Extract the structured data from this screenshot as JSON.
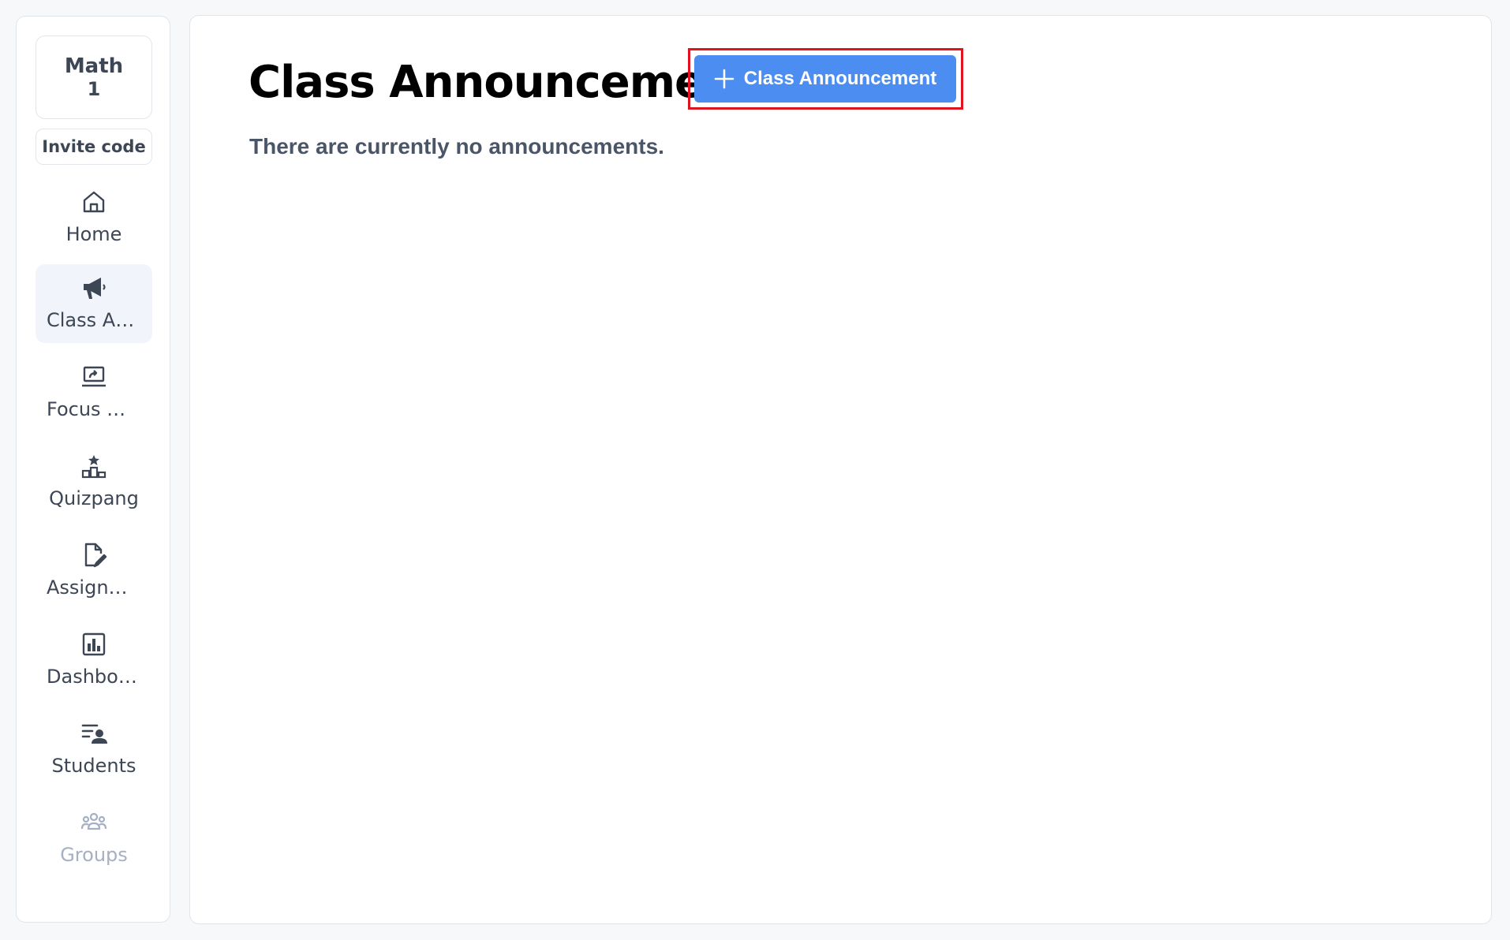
{
  "sidebar": {
    "class_name": "Math",
    "class_number": "1",
    "invite_label": "Invite code",
    "items": [
      {
        "label": "Home",
        "icon": "home-icon"
      },
      {
        "label": "Class Announcement",
        "icon": "megaphone-icon",
        "active": true
      },
      {
        "label": "Focus Mode",
        "icon": "screen-share-icon"
      },
      {
        "label": "Quizpang",
        "icon": "podium-icon"
      },
      {
        "label": "Assignment",
        "icon": "edit-document-icon"
      },
      {
        "label": "Dashboard",
        "icon": "bar-chart-icon"
      },
      {
        "label": "Students",
        "icon": "student-list-icon"
      },
      {
        "label": "Groups",
        "icon": "group-icon",
        "disabled": true
      }
    ]
  },
  "main": {
    "title": "Class Announcement",
    "add_button_label": "Class Announcement",
    "empty_message": "There are currently no announcements."
  },
  "colors": {
    "accent": "#4b8df0",
    "highlight_border": "#e0141e",
    "text": "#3d4654",
    "disabled": "#a5b0c2"
  }
}
